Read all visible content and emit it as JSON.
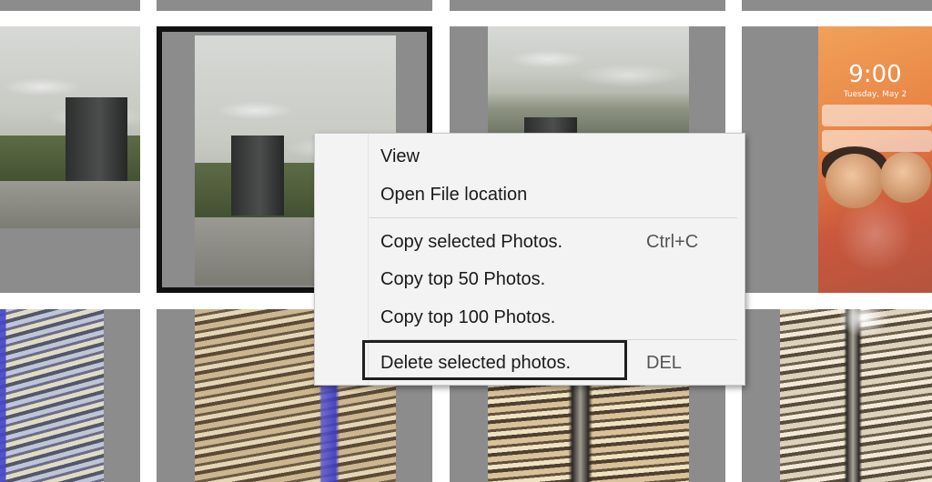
{
  "context_menu": {
    "items": [
      {
        "label": "View"
      },
      {
        "label": "Open File location"
      },
      {
        "label": "Copy selected Photos.",
        "shortcut": "Ctrl+C"
      },
      {
        "label": "Copy top 50 Photos."
      },
      {
        "label": "Copy top 100 Photos."
      },
      {
        "label": "Delete selected photos.",
        "shortcut": "DEL"
      }
    ]
  },
  "phone_thumbnail": {
    "time": "9:00",
    "date": "Tuesday, May 2"
  },
  "colors": {
    "menu_background": "#f3f3f3",
    "cell_background": "#8c8c8c",
    "selection_border": "#111111"
  }
}
